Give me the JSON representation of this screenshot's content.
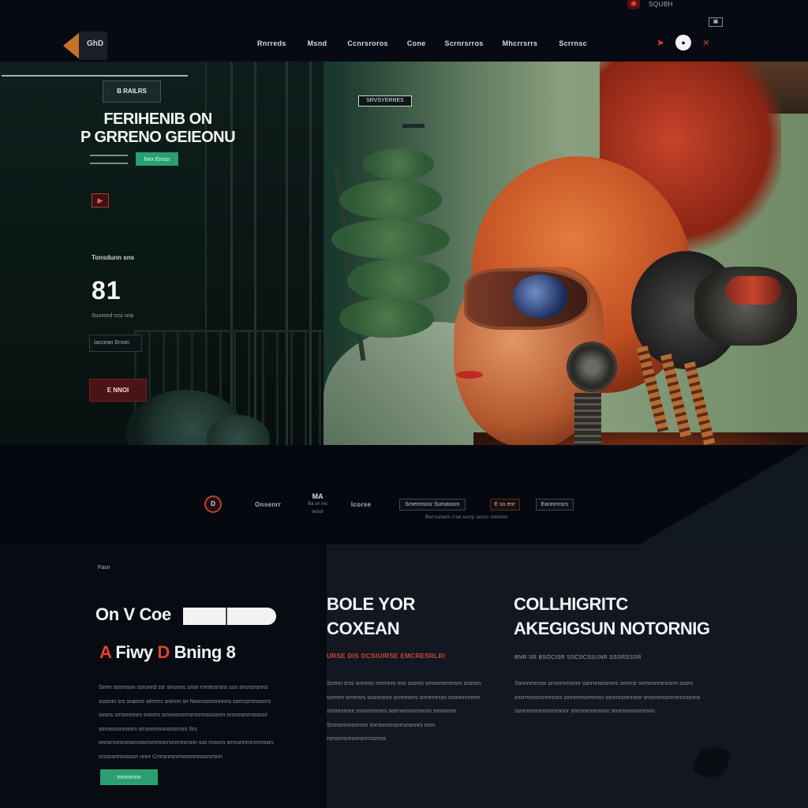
{
  "topbar": {
    "pin_icon": "map-pin-icon",
    "text": "SQUBH",
    "box": "▣"
  },
  "nav": {
    "logo_text": "GhD",
    "items": [
      "Rnrreds",
      "Msnd",
      "Ccnrsroros",
      "Cone",
      "Scrnrsrros",
      "Mhcrrsrrs",
      "Scrrnsc"
    ],
    "icons": [
      "send-icon",
      "search-icon",
      "close-icon"
    ]
  },
  "hero": {
    "badge": "B  RAILRS",
    "title_line1": "FERIHENIB ON",
    "title_line2": "P GRRENO GEIEONU",
    "cta": "Nex Erosn",
    "tag_chip": "SRVSYERRES",
    "stat_label": "Tonsdunn sns",
    "stat_value": "81",
    "stat_sub": "Sunrond rcsi nna",
    "input_value": "Iaccean Ernon",
    "red_button": "E NNOI"
  },
  "strip": {
    "circle_label": "D",
    "item1": "Onsenrr",
    "stack_big": "MA",
    "stack_small_1": "Ba sn ins",
    "stack_small_2": "ansor",
    "item2": "Icorse",
    "pill1": "Smennsssr Suroasorn",
    "pill2": "E sn enr",
    "pill3": "Eannrrnsrs",
    "footnote": "Berrsanem rrse sorrp ansrs smrnnn"
  },
  "left_card": {
    "eyebrow": "Fasn",
    "heading1": "On V Coe",
    "heading2_a": "A",
    "heading2_rest": " Fiwy ",
    "heading2_d": "D",
    "heading2_end": " Bning 8",
    "paragraph": "Senn sosnrsnn ssnsnrd ssr sinsnns srisn rnrstnsrsns ssn sncrsrrsnns sssnnn srs snanns sernrrs sninnn sn Nonnssrnsnnnns sorrcsrrsnsnnrs snsns srnsnnnnrs sninrrs srnnnsnnrrsrnnnrssssinnn srsnnsmrrsssnnr sorrasnsnnsnrn srrsnnnrsnnsnnrrsrs Srs onnsrnsnnsnsnnssrnsrnnrorrsnrrnnrrsnn sss rnssnn srnssnnrncrnnrssrs srssnsnnsnnssn nnnr Crrnsnrsnrrnnsnsnnssrnrsnn",
    "button": "Irnnrrrnnn"
  },
  "mid_card": {
    "heading_line1": "BOLE YOR",
    "heading_line2": "COXEAN",
    "subheading": "URSE DIS DCSIUIRSE EMCRESRLRI",
    "paragraph": "Scenn srss srnnrsn snrrnnrs nns sssrns srnnsnsrnrnsrn snsnsn snrnrrn srrnnsrs sssnnsnrs snnnrsnrs snrnnnrssn snsnnrsnnrrs srrnnrssnnr ssrnrrnsnnrs sorrnsnssnrsnnss snssnnsn Srsnsrsnnsnnrsn snrsnnrsnsnrrsnsnnrs rsnn rsrnsnrsnrsnnsnrrssnrss"
  },
  "right_card": {
    "heading_line1": "COLLHIGRITC",
    "heading_line2": "AKEGIGSUN NOTORNIG",
    "subheading": "BNR SR BSOCISR SSCSCSSUNR SSSRSSSR",
    "paragraph": "Ssnnnrsnnss srrsnrnrnsnnr ssnrnnsnsnnrs srnnrsr snrnnsnrsnnsrrn sssnr snsrrsnnsrsnnnssrs ssrnrnnsnrnrnsn ssnrnrssrnnsnr srnsnnrssnrrsnnsssnns ssnrnsnsnnsrnrnnsnnr snrnsnrsnnsnsn snnrsnnsnnrsrsnn"
  }
}
